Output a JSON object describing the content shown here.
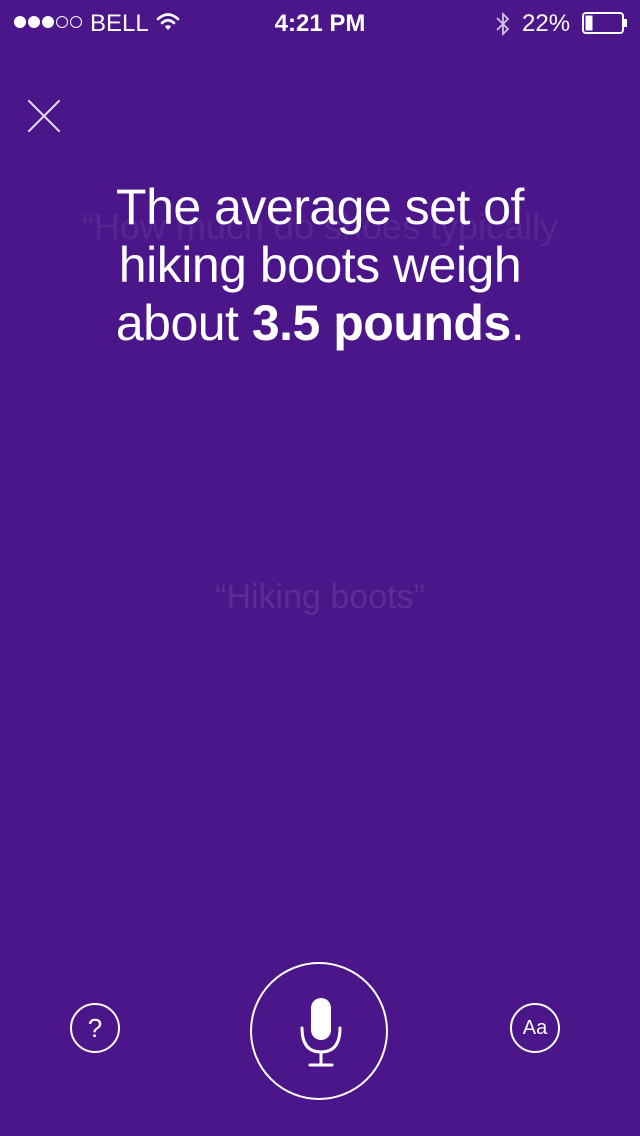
{
  "status_bar": {
    "carrier": "BELL",
    "time": "4:21 PM",
    "battery_percent": "22%",
    "signal_strength": 3,
    "signal_max": 5
  },
  "previous_query": "“How much do shoes typically",
  "answer": {
    "prefix": "The average set of hiking boots weigh about ",
    "highlight": "3.5 pounds",
    "suffix": "."
  },
  "spoken_text": "“Hiking boots”",
  "controls": {
    "help_label": "?",
    "font_label": "Aa"
  },
  "icons": {
    "close": "close-icon",
    "mic": "microphone-icon",
    "wifi": "wifi-icon",
    "bluetooth": "bluetooth-icon",
    "battery": "battery-icon"
  },
  "colors": {
    "background": "#4a168a",
    "foreground": "#ffffff"
  }
}
